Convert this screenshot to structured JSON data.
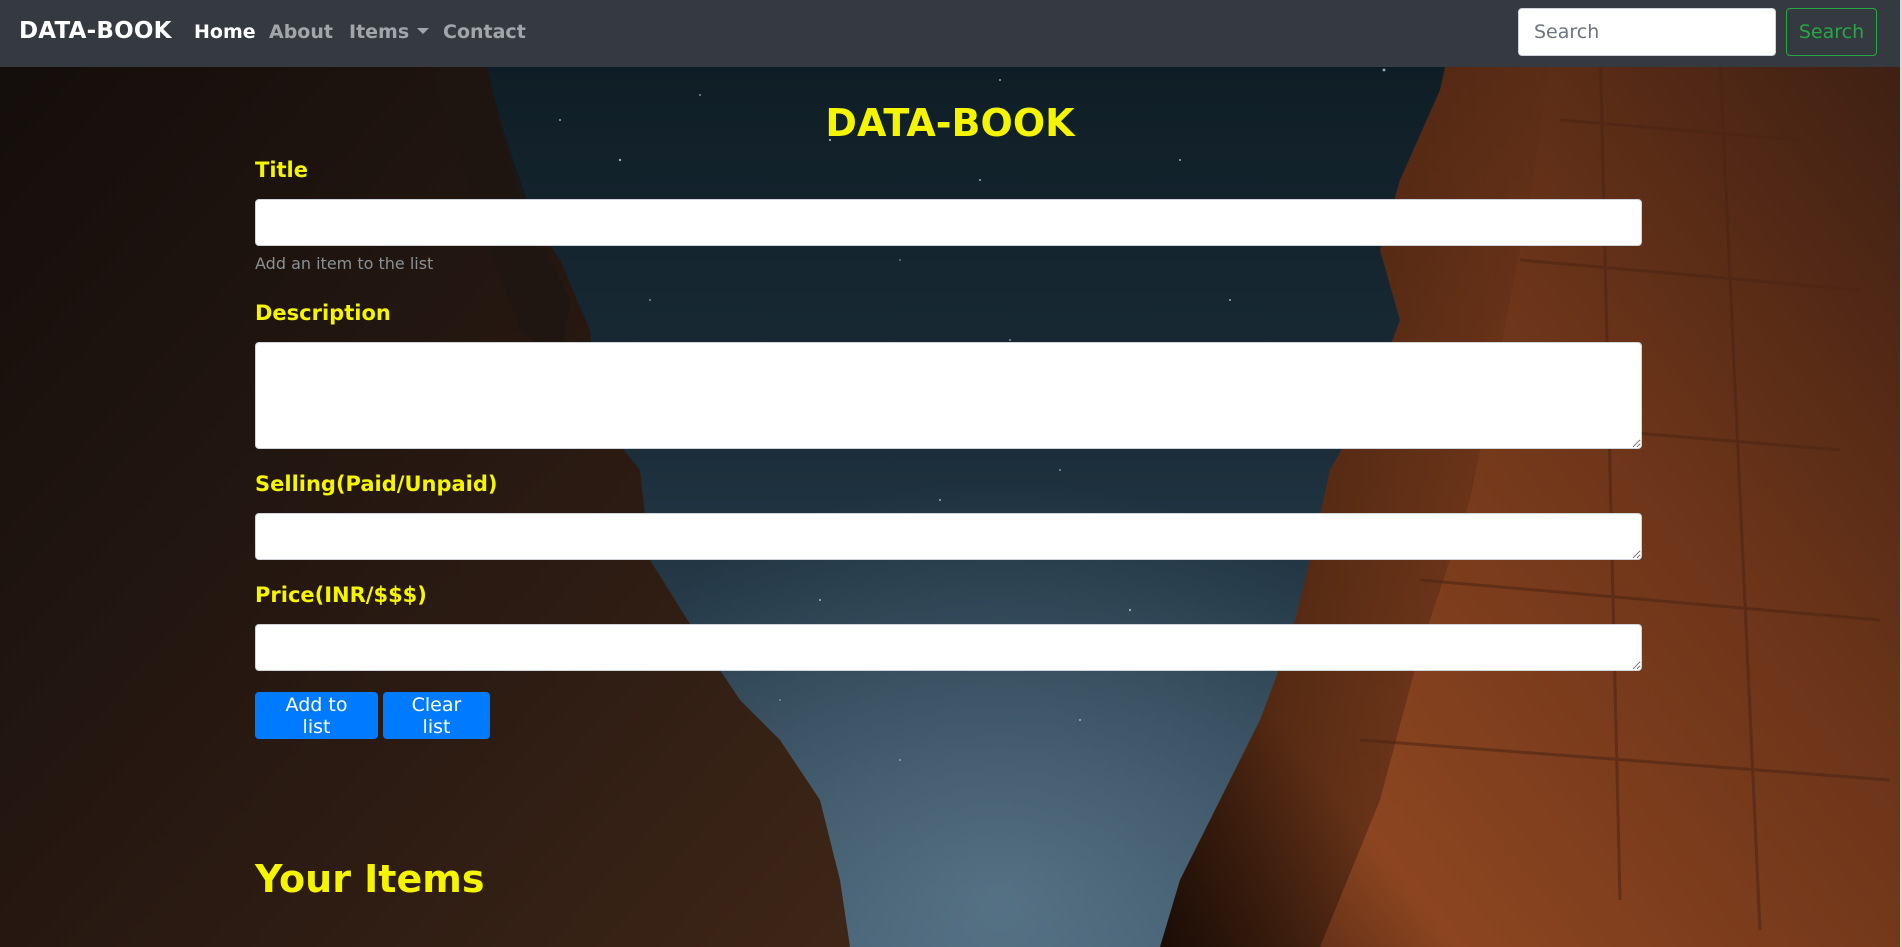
{
  "navbar": {
    "brand": "DATA-BOOK",
    "links": [
      {
        "label": "Home",
        "active": true
      },
      {
        "label": "About",
        "active": false
      },
      {
        "label": "Items",
        "active": false,
        "dropdown": true
      },
      {
        "label": "Contact",
        "active": false
      }
    ],
    "search": {
      "placeholder": "Search",
      "button_label": "Search"
    }
  },
  "form": {
    "heading": "DATA-BOOK",
    "title_label": "Title",
    "title_value": "",
    "title_help": "Add an item to the list",
    "description_label": "Description",
    "description_value": "",
    "selling_label": "Selling(Paid/Unpaid)",
    "selling_value": "",
    "price_label": "Price(INR/$$$)",
    "price_value": "",
    "add_button": "Add to list",
    "clear_button": "Clear list"
  },
  "items_section": {
    "heading": "Your Items"
  },
  "colors": {
    "navbar_bg": "#343a40",
    "heading_yellow": "#f5f500",
    "primary_blue": "#007bff",
    "search_green": "#28a745"
  }
}
